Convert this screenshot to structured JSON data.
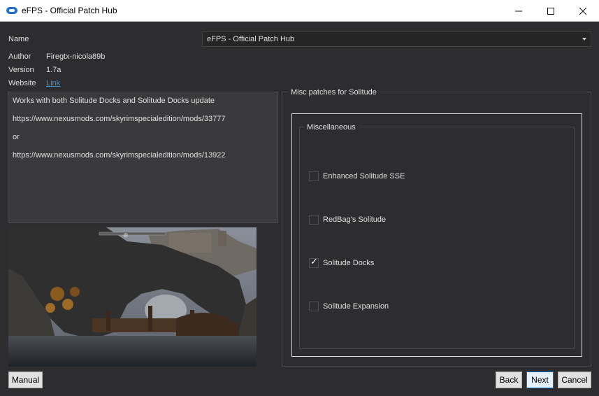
{
  "window": {
    "title": "eFPS - Official Patch Hub"
  },
  "info": {
    "name_label": "Name",
    "name_value": "eFPS - Official Patch Hub",
    "author_label": "Author",
    "author_value": "Firegtx-nicola89b",
    "version_label": "Version",
    "version_value": "1.7a",
    "website_label": "Website",
    "website_value": "Link"
  },
  "description": {
    "lines": [
      "Works with both Solitude Docks and Solitude Docks update",
      "https://www.nexusmods.com/skyrimspecialedition/mods/33777",
      "or",
      "https://www.nexusmods.com/skyrimspecialedition/mods/13922"
    ]
  },
  "options": {
    "group_title": "Misc patches for Solitude",
    "subgroup_title": "Miscellaneous",
    "items": [
      {
        "label": "Enhanced Solitude SSE",
        "checked": false
      },
      {
        "label": "RedBag's Solitude",
        "checked": false
      },
      {
        "label": "Solitude Docks",
        "checked": true
      },
      {
        "label": "Solitude Expansion",
        "checked": false
      }
    ]
  },
  "buttons": {
    "manual": "Manual",
    "back": "Back",
    "next": "Next",
    "cancel": "Cancel"
  },
  "icons": {
    "app": "app-logo-icon",
    "minimize": "minimize-icon",
    "maximize": "maximize-icon",
    "close": "close-icon",
    "dropdown": "chevron-down-icon"
  },
  "colors": {
    "background": "#2d2d30",
    "link": "#3a96dd",
    "focus": "#0078d7"
  }
}
